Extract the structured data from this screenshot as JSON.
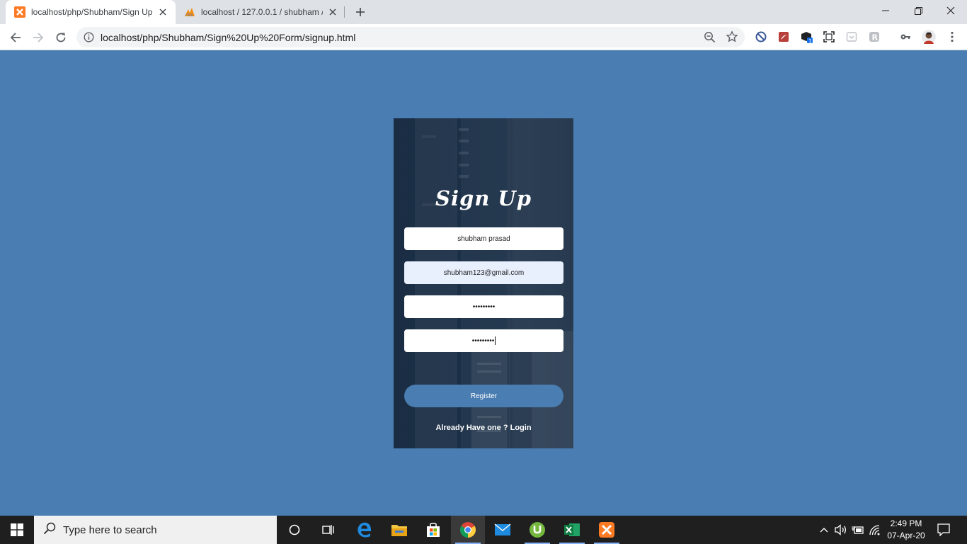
{
  "browser": {
    "tabs": [
      {
        "title": "localhost/php/Shubham/Sign Up",
        "icon": "xampp-icon",
        "active": true
      },
      {
        "title": "localhost / 127.0.0.1 / shubham /",
        "icon": "phpmyadmin-icon",
        "active": false
      }
    ],
    "url": "localhost/php/Shubham/Sign%20Up%20Form/signup.html"
  },
  "form": {
    "title": "Sign Up",
    "name_value": "shubham prasad",
    "email_value": "shubham123@gmail.com",
    "password_mask": "•••••••••",
    "confirm_mask": "•••••••••",
    "register_label": "Register",
    "login_prompt": "Already Have one ? Login"
  },
  "taskbar": {
    "search_placeholder": "Type here to search",
    "time": "2:49 PM",
    "date": "07-Apr-20"
  },
  "colors": {
    "page_background": "#4a7db1",
    "card_background": "#1a2d44",
    "accent": "#4a7db1",
    "autofill": "#e8f0fe"
  }
}
